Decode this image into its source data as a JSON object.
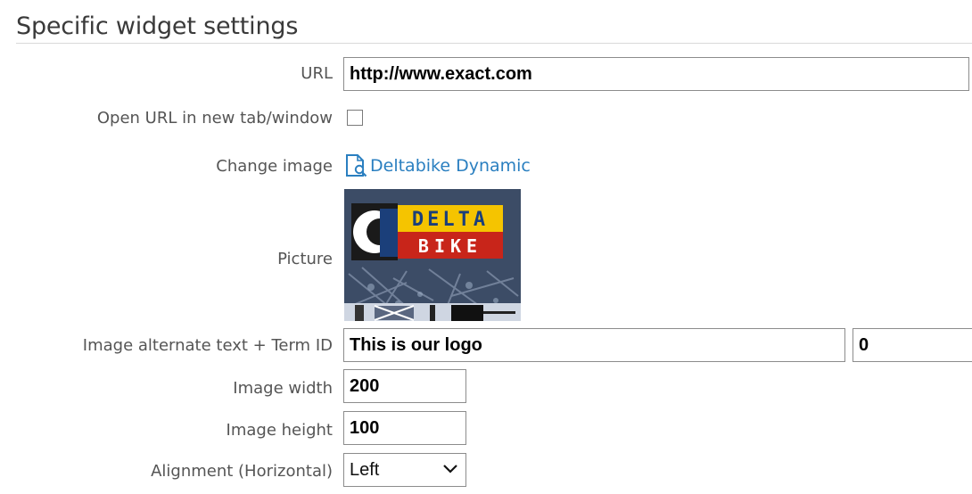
{
  "section_title": "Specific widget settings",
  "fields": {
    "url": {
      "label": "URL",
      "value": "http://www.exact.com"
    },
    "open_new_tab": {
      "label": "Open URL in new tab/window",
      "checked": false
    },
    "change_image": {
      "label": "Change image",
      "link_text": "Deltabike Dynamic"
    },
    "picture": {
      "label": "Picture",
      "logo_text_top": "DELTA",
      "logo_text_bottom": "BIKE"
    },
    "alt_text": {
      "label": "Image alternate text + Term ID",
      "value": "This is our logo",
      "term_id": "0"
    },
    "width": {
      "label": "Image width",
      "value": "200"
    },
    "height": {
      "label": "Image height",
      "value": "100"
    },
    "alignment": {
      "label": "Alignment (Horizontal)",
      "value": "Left"
    }
  },
  "colors": {
    "link": "#2a7fc0",
    "logo_yellow": "#f5c400",
    "logo_red": "#c8251a",
    "logo_blue": "#1b3f7a"
  },
  "icons": {
    "change_image": "document-search-icon",
    "select": "chevron-down-icon"
  }
}
